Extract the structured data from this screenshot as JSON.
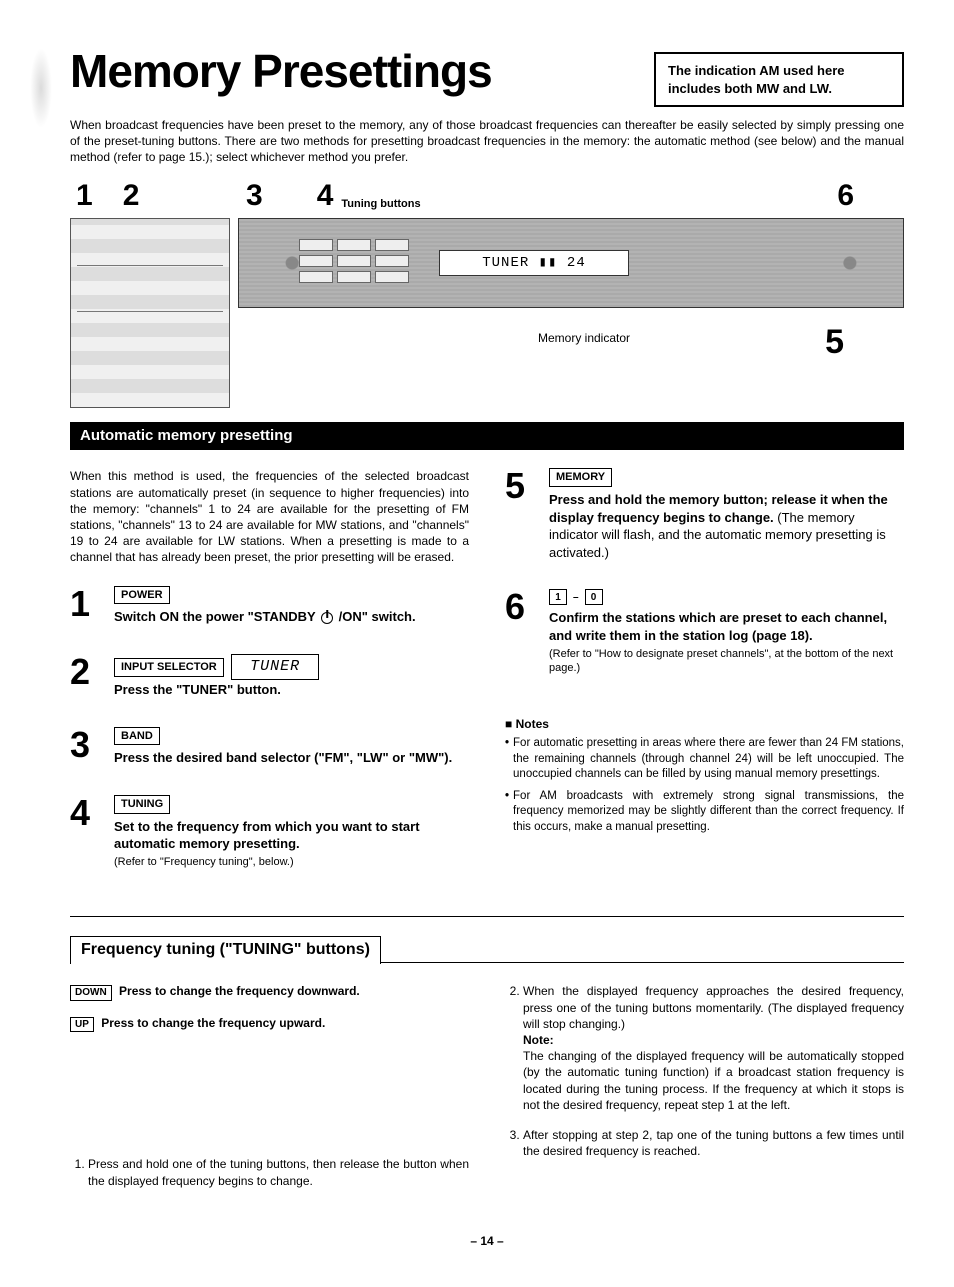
{
  "header": {
    "title": "Memory Presettings",
    "noteBox": "The indication AM used here includes both MW and LW."
  },
  "intro": "When broadcast frequencies have been preset to the memory, any of those broadcast frequencies can thereafter be easily selected by simply pressing one of the preset-tuning buttons. There are two methods for presetting broadcast frequencies in the memory: the automatic method (see below) and the manual method (refer to page 15.); select whichever method you prefer.",
  "diagram": {
    "n1": "1",
    "n2": "2",
    "n3": "3",
    "n4": "4",
    "n5": "5",
    "n6": "6",
    "tuningButtons": "Tuning buttons",
    "lcd": "TUNER ▮▮ 24",
    "memIndicator": "Memory indicator"
  },
  "section1": "Automatic memory presetting",
  "autoIntro": "When this method is used, the frequencies of the selected broadcast stations are automatically preset (in sequence to higher frequencies) into the memory: \"channels\" 1 to 24 are available for the presetting of FM stations, \"channels\" 13 to 24 are available for MW stations, and \"channels\" 19 to 24 are available for LW stations. When a presetting is made to a channel that has already been preset, the prior presetting will be erased.",
  "steps": {
    "s1": {
      "num": "1",
      "label": "POWER",
      "titleA": "Switch ON the power \"STANDBY ",
      "titleB": " /ON\" switch."
    },
    "s2": {
      "num": "2",
      "label": "INPUT SELECTOR",
      "title": "Press the \"TUNER\" button.",
      "lcd": "TUNER"
    },
    "s3": {
      "num": "3",
      "label": "BAND",
      "title": "Press the desired band selector (\"FM\", \"LW\" or \"MW\")."
    },
    "s4": {
      "num": "4",
      "label": "TUNING",
      "title": "Set to the frequency from which you want to start automatic memory presetting.",
      "sub": "(Refer to \"Frequency tuning\", below.)"
    },
    "s5": {
      "num": "5",
      "label": "MEMORY",
      "title": "Press and hold the memory button; release it when the display frequency begins to change.",
      "tail": " (The memory indicator will flash, and the automatic memory presetting is activated.)"
    },
    "s6": {
      "num": "6",
      "b1": "1",
      "b0": "0",
      "title": "Confirm the stations which are preset to each channel, and write them in the station log (page 18).",
      "sub": "(Refer to \"How to designate preset channels\", at the bottom of the next page.)"
    }
  },
  "notesHeading": "Notes",
  "notes": {
    "n1": "For automatic presetting in areas where there are fewer than 24 FM stations, the remaining channels (through channel 24) will be left unoccupied. The unoccupied channels can be filled by using manual memory presettings.",
    "n2": "For AM broadcasts with extremely strong signal transmissions, the frequency memorized may be slightly different than the correct frequency. If this occurs, make a manual presetting."
  },
  "freq": {
    "heading": "Frequency tuning (\"TUNING\" buttons)",
    "down": "DOWN",
    "downTxt": "Press to change the frequency downward.",
    "up": "UP",
    "upTxt": "Press to change the frequency upward.",
    "li1": "Press and hold one of the tuning buttons, then release the button when the displayed frequency begins to change.",
    "li2a": "When the displayed frequency approaches the desired frequency, press one of the tuning buttons momentarily. (The displayed frequency will stop changing.)",
    "noteLabel": "Note:",
    "li2b": "The changing of the displayed frequency will be automatically stopped (by the automatic tuning function) if a broadcast station frequency is located during the tuning process. If the frequency at which it stops is not the desired frequency, repeat step 1 at the left.",
    "li3": "After stopping at step 2, tap one of the tuning buttons a few times until the desired frequency is reached."
  },
  "pageNum": "– 14 –"
}
